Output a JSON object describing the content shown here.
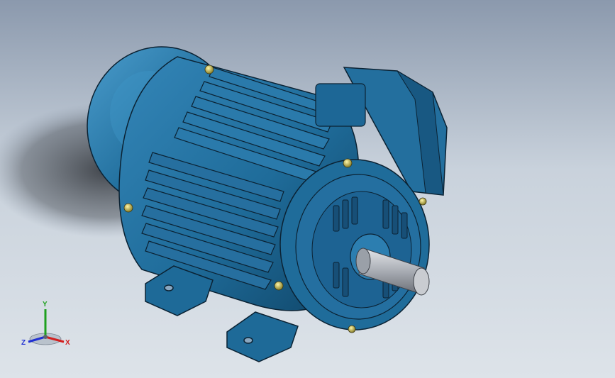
{
  "viewport": {
    "background_top": "#8b99ad",
    "background_bottom": "#dde3e9"
  },
  "model": {
    "body_color": "#1f6c9a",
    "edge_color": "#0b2233",
    "shaft_color": "#b8bcc2",
    "bolt_color": "#d9cf6a"
  },
  "triad": {
    "x_label": "X",
    "y_label": "Y",
    "z_label": "Z",
    "x_color": "#d22020",
    "y_color": "#1ea01e",
    "z_color": "#2030d2"
  }
}
